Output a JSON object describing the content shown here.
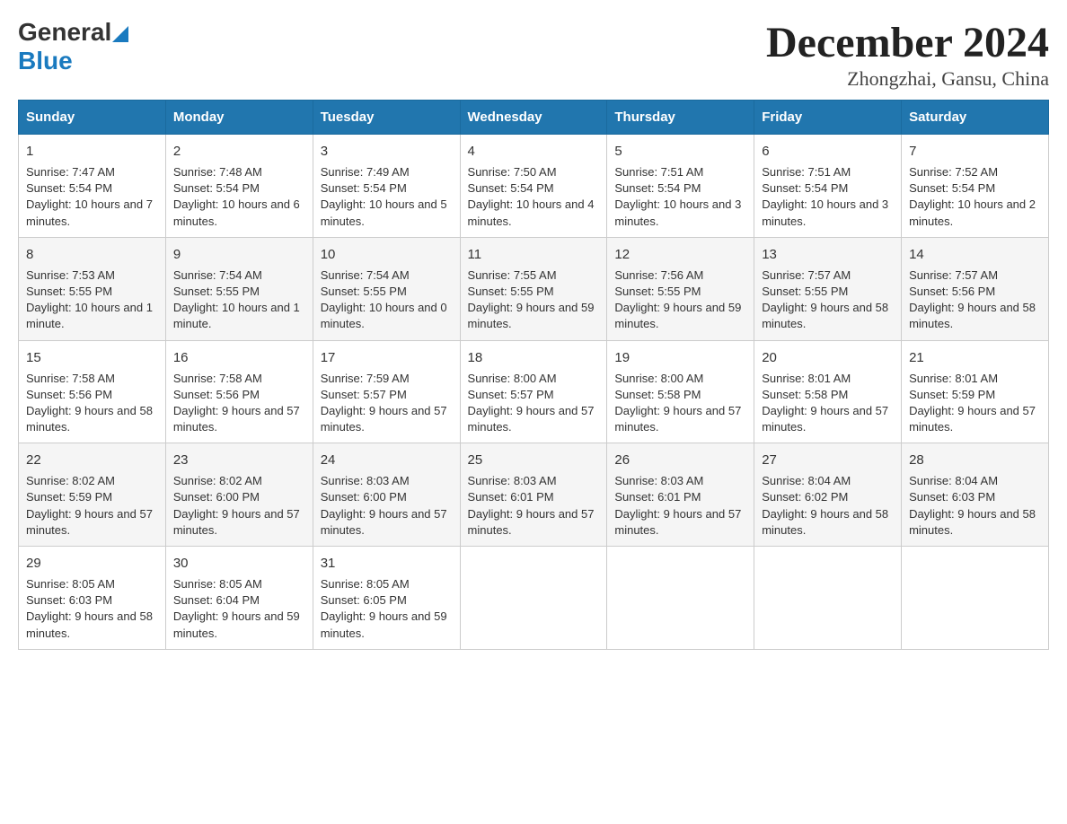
{
  "logo": {
    "general": "General",
    "blue": "Blue"
  },
  "title": "December 2024",
  "subtitle": "Zhongzhai, Gansu, China",
  "headers": [
    "Sunday",
    "Monday",
    "Tuesday",
    "Wednesday",
    "Thursday",
    "Friday",
    "Saturday"
  ],
  "weeks": [
    [
      {
        "day": "1",
        "sunrise": "Sunrise: 7:47 AM",
        "sunset": "Sunset: 5:54 PM",
        "daylight": "Daylight: 10 hours and 7 minutes."
      },
      {
        "day": "2",
        "sunrise": "Sunrise: 7:48 AM",
        "sunset": "Sunset: 5:54 PM",
        "daylight": "Daylight: 10 hours and 6 minutes."
      },
      {
        "day": "3",
        "sunrise": "Sunrise: 7:49 AM",
        "sunset": "Sunset: 5:54 PM",
        "daylight": "Daylight: 10 hours and 5 minutes."
      },
      {
        "day": "4",
        "sunrise": "Sunrise: 7:50 AM",
        "sunset": "Sunset: 5:54 PM",
        "daylight": "Daylight: 10 hours and 4 minutes."
      },
      {
        "day": "5",
        "sunrise": "Sunrise: 7:51 AM",
        "sunset": "Sunset: 5:54 PM",
        "daylight": "Daylight: 10 hours and 3 minutes."
      },
      {
        "day": "6",
        "sunrise": "Sunrise: 7:51 AM",
        "sunset": "Sunset: 5:54 PM",
        "daylight": "Daylight: 10 hours and 3 minutes."
      },
      {
        "day": "7",
        "sunrise": "Sunrise: 7:52 AM",
        "sunset": "Sunset: 5:54 PM",
        "daylight": "Daylight: 10 hours and 2 minutes."
      }
    ],
    [
      {
        "day": "8",
        "sunrise": "Sunrise: 7:53 AM",
        "sunset": "Sunset: 5:55 PM",
        "daylight": "Daylight: 10 hours and 1 minute."
      },
      {
        "day": "9",
        "sunrise": "Sunrise: 7:54 AM",
        "sunset": "Sunset: 5:55 PM",
        "daylight": "Daylight: 10 hours and 1 minute."
      },
      {
        "day": "10",
        "sunrise": "Sunrise: 7:54 AM",
        "sunset": "Sunset: 5:55 PM",
        "daylight": "Daylight: 10 hours and 0 minutes."
      },
      {
        "day": "11",
        "sunrise": "Sunrise: 7:55 AM",
        "sunset": "Sunset: 5:55 PM",
        "daylight": "Daylight: 9 hours and 59 minutes."
      },
      {
        "day": "12",
        "sunrise": "Sunrise: 7:56 AM",
        "sunset": "Sunset: 5:55 PM",
        "daylight": "Daylight: 9 hours and 59 minutes."
      },
      {
        "day": "13",
        "sunrise": "Sunrise: 7:57 AM",
        "sunset": "Sunset: 5:55 PM",
        "daylight": "Daylight: 9 hours and 58 minutes."
      },
      {
        "day": "14",
        "sunrise": "Sunrise: 7:57 AM",
        "sunset": "Sunset: 5:56 PM",
        "daylight": "Daylight: 9 hours and 58 minutes."
      }
    ],
    [
      {
        "day": "15",
        "sunrise": "Sunrise: 7:58 AM",
        "sunset": "Sunset: 5:56 PM",
        "daylight": "Daylight: 9 hours and 58 minutes."
      },
      {
        "day": "16",
        "sunrise": "Sunrise: 7:58 AM",
        "sunset": "Sunset: 5:56 PM",
        "daylight": "Daylight: 9 hours and 57 minutes."
      },
      {
        "day": "17",
        "sunrise": "Sunrise: 7:59 AM",
        "sunset": "Sunset: 5:57 PM",
        "daylight": "Daylight: 9 hours and 57 minutes."
      },
      {
        "day": "18",
        "sunrise": "Sunrise: 8:00 AM",
        "sunset": "Sunset: 5:57 PM",
        "daylight": "Daylight: 9 hours and 57 minutes."
      },
      {
        "day": "19",
        "sunrise": "Sunrise: 8:00 AM",
        "sunset": "Sunset: 5:58 PM",
        "daylight": "Daylight: 9 hours and 57 minutes."
      },
      {
        "day": "20",
        "sunrise": "Sunrise: 8:01 AM",
        "sunset": "Sunset: 5:58 PM",
        "daylight": "Daylight: 9 hours and 57 minutes."
      },
      {
        "day": "21",
        "sunrise": "Sunrise: 8:01 AM",
        "sunset": "Sunset: 5:59 PM",
        "daylight": "Daylight: 9 hours and 57 minutes."
      }
    ],
    [
      {
        "day": "22",
        "sunrise": "Sunrise: 8:02 AM",
        "sunset": "Sunset: 5:59 PM",
        "daylight": "Daylight: 9 hours and 57 minutes."
      },
      {
        "day": "23",
        "sunrise": "Sunrise: 8:02 AM",
        "sunset": "Sunset: 6:00 PM",
        "daylight": "Daylight: 9 hours and 57 minutes."
      },
      {
        "day": "24",
        "sunrise": "Sunrise: 8:03 AM",
        "sunset": "Sunset: 6:00 PM",
        "daylight": "Daylight: 9 hours and 57 minutes."
      },
      {
        "day": "25",
        "sunrise": "Sunrise: 8:03 AM",
        "sunset": "Sunset: 6:01 PM",
        "daylight": "Daylight: 9 hours and 57 minutes."
      },
      {
        "day": "26",
        "sunrise": "Sunrise: 8:03 AM",
        "sunset": "Sunset: 6:01 PM",
        "daylight": "Daylight: 9 hours and 57 minutes."
      },
      {
        "day": "27",
        "sunrise": "Sunrise: 8:04 AM",
        "sunset": "Sunset: 6:02 PM",
        "daylight": "Daylight: 9 hours and 58 minutes."
      },
      {
        "day": "28",
        "sunrise": "Sunrise: 8:04 AM",
        "sunset": "Sunset: 6:03 PM",
        "daylight": "Daylight: 9 hours and 58 minutes."
      }
    ],
    [
      {
        "day": "29",
        "sunrise": "Sunrise: 8:05 AM",
        "sunset": "Sunset: 6:03 PM",
        "daylight": "Daylight: 9 hours and 58 minutes."
      },
      {
        "day": "30",
        "sunrise": "Sunrise: 8:05 AM",
        "sunset": "Sunset: 6:04 PM",
        "daylight": "Daylight: 9 hours and 59 minutes."
      },
      {
        "day": "31",
        "sunrise": "Sunrise: 8:05 AM",
        "sunset": "Sunset: 6:05 PM",
        "daylight": "Daylight: 9 hours and 59 minutes."
      },
      null,
      null,
      null,
      null
    ]
  ]
}
